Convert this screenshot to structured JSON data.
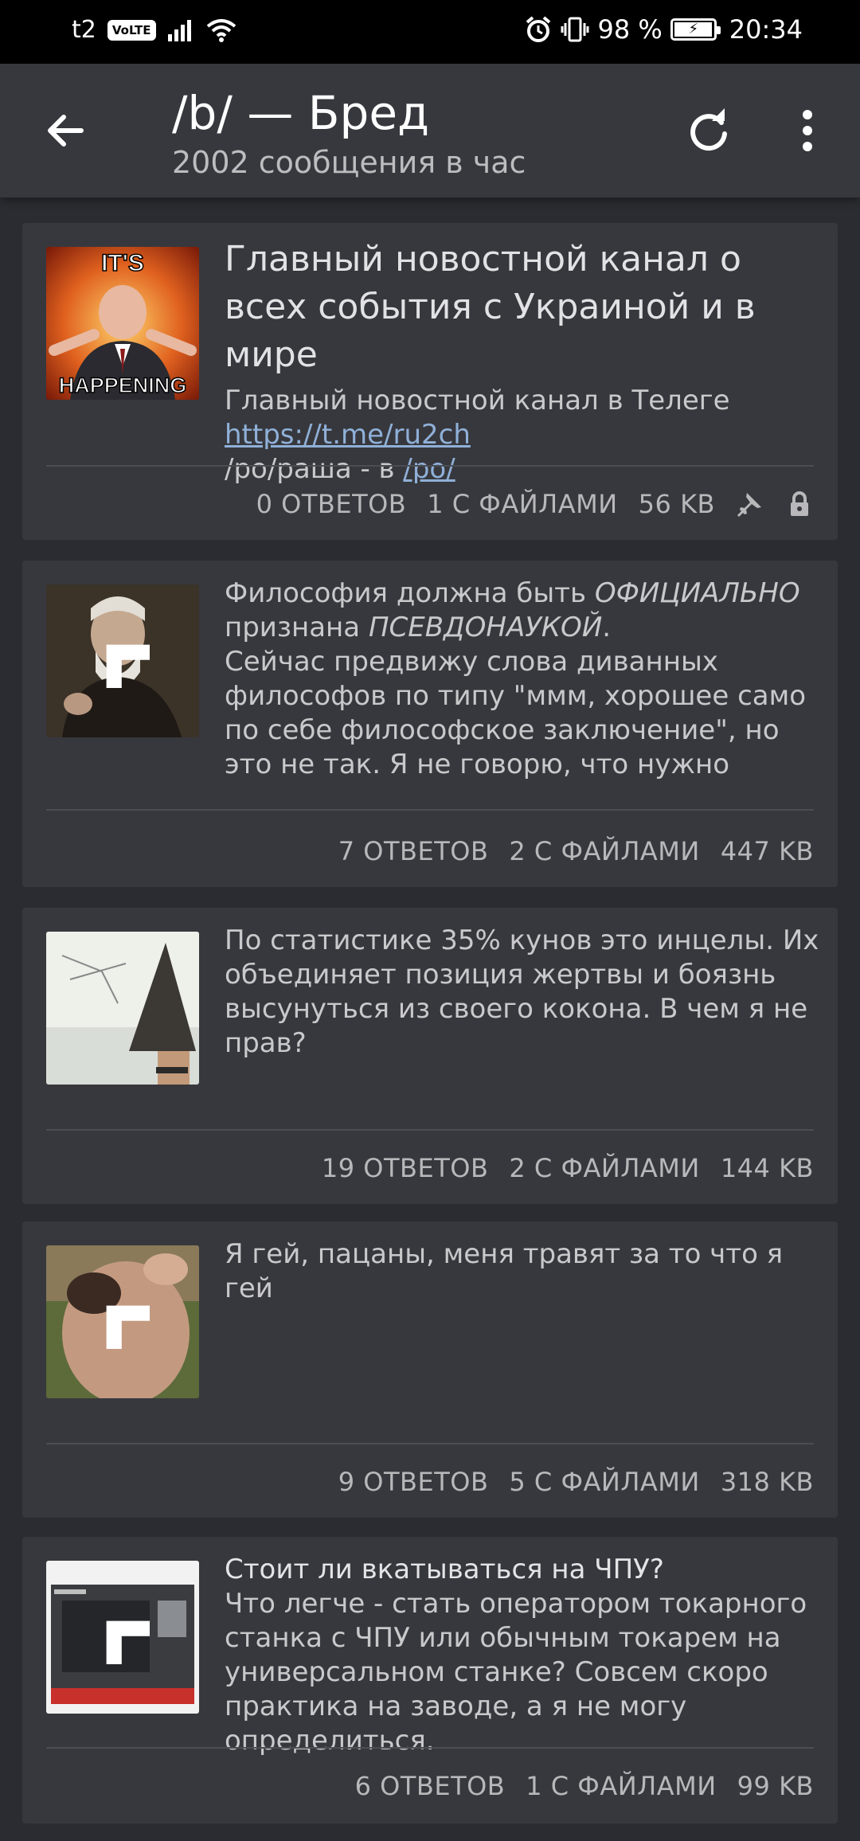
{
  "status_bar": {
    "carrier": "t2",
    "volte": "VoLTE",
    "battery": "98 %",
    "battery_level": 0.98,
    "time": "20:34"
  },
  "toolbar": {
    "title": "/b/ — Бред",
    "subtitle": "2002 сообщения в час"
  },
  "threads": [
    {
      "subject": "Главный новостной канал о всех события с Украиной и в мире",
      "line1": "Главный новостной канал в Телеге",
      "link": "https://t.me/ru2ch",
      "line3_prefix": "/po/раша - в ",
      "line3_link": "/po/",
      "thumb_caption_top": "IT'S",
      "thumb_caption_bottom": "HAPPENING",
      "replies": "0 ОТВЕТОВ",
      "files": "1 С ФАЙЛАМИ",
      "size": "56 KB",
      "pinned": true,
      "locked": true
    },
    {
      "text_a": "Философия должна быть ",
      "text_b": "ОФИЦИАЛЬНО",
      "text_c": " признана ",
      "text_d": "ПСЕВДОНАУКОЙ",
      "text_e": ".",
      "text_f": "Сейчас предвижу слова диванных философов по типу \"ммм, хорошее само по себе философское заключение\", но это не так. Я не говорю, что нужно",
      "replies": "7 ОТВЕТОВ",
      "files": "2 С ФАЙЛАМИ",
      "size": "447 KB"
    },
    {
      "text": "По статистике 35% кунов это инцелы. Их объединяет позиция жертвы и боязнь высунуться из своего кокона. В чем я не прав?",
      "replies": "19 ОТВЕТОВ",
      "files": "2 С ФАЙЛАМИ",
      "size": "144 KB"
    },
    {
      "text": "Я гей, пацаны, меня травят за то что я гей",
      "replies": "9 ОТВЕТОВ",
      "files": "5 С ФАЙЛАМИ",
      "size": "318 KB"
    },
    {
      "subject": "Стоит ли вкатываться на ЧПУ?",
      "text": "Что легче - стать оператором токарного станка с ЧПУ или обычным токарем на универсальном станке? Совсем скоро практика на заводе, а я не могу определиться.",
      "replies": "6 ОТВЕТОВ",
      "files": "1 С ФАЙЛАМИ",
      "size": "99 KB"
    }
  ],
  "colors": {
    "background": "#2b2c31",
    "card": "#37383d",
    "link": "#8fb0d8",
    "status_bar": "#000000"
  },
  "icons": [
    "back-arrow-icon",
    "refresh-icon",
    "more-vert-icon",
    "pin-icon",
    "lock-icon",
    "expand-icon",
    "alarm-icon",
    "vibrate-icon",
    "signal-icon",
    "wifi-icon",
    "battery-icon"
  ]
}
